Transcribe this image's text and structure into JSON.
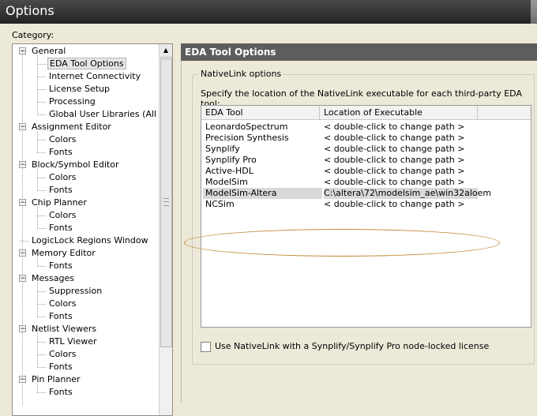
{
  "window": {
    "title": "Options"
  },
  "category": {
    "label": "Category:",
    "items": [
      {
        "label": "General",
        "level": 0,
        "expanded": true
      },
      {
        "label": "EDA Tool Options",
        "level": 1,
        "selected": true
      },
      {
        "label": "Internet Connectivity",
        "level": 1
      },
      {
        "label": "License Setup",
        "level": 1
      },
      {
        "label": "Processing",
        "level": 1
      },
      {
        "label": "Global User Libraries (All Proje",
        "level": 1
      },
      {
        "label": "Assignment Editor",
        "level": 0,
        "expanded": true
      },
      {
        "label": "Colors",
        "level": 1
      },
      {
        "label": "Fonts",
        "level": 1
      },
      {
        "label": "Block/Symbol Editor",
        "level": 0,
        "expanded": true
      },
      {
        "label": "Colors",
        "level": 1
      },
      {
        "label": "Fonts",
        "level": 1
      },
      {
        "label": "Chip Planner",
        "level": 0,
        "expanded": true
      },
      {
        "label": "Colors",
        "level": 1
      },
      {
        "label": "Fonts",
        "level": 1
      },
      {
        "label": "LogicLock Regions Window",
        "level": 0,
        "leaf": true
      },
      {
        "label": "Memory Editor",
        "level": 0,
        "expanded": true
      },
      {
        "label": "Fonts",
        "level": 1
      },
      {
        "label": "Messages",
        "level": 0,
        "expanded": true
      },
      {
        "label": "Suppression",
        "level": 1
      },
      {
        "label": "Colors",
        "level": 1
      },
      {
        "label": "Fonts",
        "level": 1
      },
      {
        "label": "Netlist Viewers",
        "level": 0,
        "expanded": true
      },
      {
        "label": "RTL Viewer",
        "level": 1
      },
      {
        "label": "Colors",
        "level": 1
      },
      {
        "label": "Fonts",
        "level": 1
      },
      {
        "label": "Pin Planner",
        "level": 0,
        "expanded": true
      },
      {
        "label": "Fonts",
        "level": 1
      }
    ]
  },
  "panel": {
    "title": "EDA Tool Options",
    "group_title": "NativeLink options",
    "instruction": "Specify the location of the NativeLink executable for each third-party EDA tool:",
    "columns": [
      "EDA Tool",
      "Location of Executable"
    ],
    "rows": [
      {
        "tool": "LeonardoSpectrum",
        "location": "< double-click to change path >"
      },
      {
        "tool": "Precision Synthesis",
        "location": "< double-click to change path >"
      },
      {
        "tool": "Synplify",
        "location": "< double-click to change path >"
      },
      {
        "tool": "Synplify Pro",
        "location": "< double-click to change path >"
      },
      {
        "tool": "Active-HDL",
        "location": "< double-click to change path >"
      },
      {
        "tool": "ModelSim",
        "location": "< double-click to change path >"
      },
      {
        "tool": "ModelSim-Altera",
        "location": "C:\\altera\\72\\modelsim_ae\\win32aloem",
        "selected": true
      },
      {
        "tool": "NCSim",
        "location": "< double-click to change path >"
      }
    ],
    "checkbox_label": "Use NativeLink with a Synplify/Synplify Pro node-locked license",
    "checkbox_checked": false
  },
  "colors": {
    "titlebar": "#2f2f2f",
    "panel_header": "#5d5d5d",
    "highlight_ellipse": "#c48a3a",
    "dialog_bg": "#ece9d8"
  }
}
